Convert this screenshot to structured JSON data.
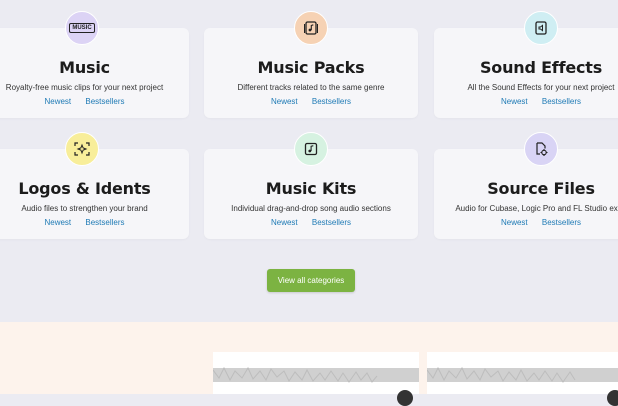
{
  "categories": [
    {
      "title": "Music",
      "description": "Royalty-free music clips for your next project",
      "link_newest": "Newest",
      "link_bestsellers": "Bestsellers",
      "icon": "music-text-icon",
      "icon_bg": "#dcd3f5",
      "icon_text": "MUSIC"
    },
    {
      "title": "Music Packs",
      "description": "Different tracks related to the same genre",
      "link_newest": "Newest",
      "link_bestsellers": "Bestsellers",
      "icon": "music-pack-icon",
      "icon_bg": "#f6d2b4"
    },
    {
      "title": "Sound Effects",
      "description": "All the Sound Effects for your next project",
      "link_newest": "Newest",
      "link_bestsellers": "Bestsellers",
      "icon": "sound-effects-icon",
      "icon_bg": "#cfeef3"
    },
    {
      "title": "Logos & Idents",
      "description": "Audio files to strengthen your brand",
      "link_newest": "Newest",
      "link_bestsellers": "Bestsellers",
      "icon": "logo-sparkle-icon",
      "icon_bg": "#f8ee9a"
    },
    {
      "title": "Music Kits",
      "description": "Individual drag-and-drop song audio sections",
      "link_newest": "Newest",
      "link_bestsellers": "Bestsellers",
      "icon": "music-kit-icon",
      "icon_bg": "#d6f2e1"
    },
    {
      "title": "Source Files",
      "description": "Audio for Cubase, Logic Pro and FL Studio expe",
      "link_newest": "Newest",
      "link_bestsellers": "Bestsellers",
      "icon": "source-file-gear-icon",
      "icon_bg": "#d9d4f5"
    }
  ],
  "view_all_label": "View all categories",
  "colors": {
    "accent_green": "#7cb342",
    "link_blue": "#1e7ab5"
  }
}
